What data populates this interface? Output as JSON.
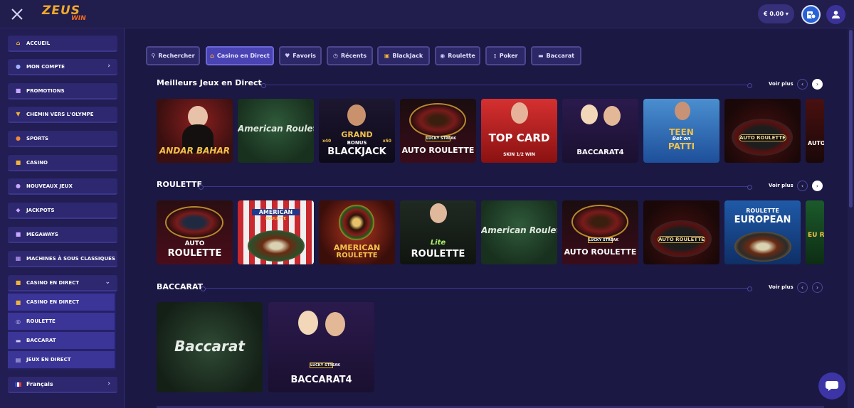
{
  "brand": {
    "logo_top": "ZEUS",
    "logo_bottom": "WIN"
  },
  "header": {
    "balance": "€ 0.00 ▾"
  },
  "sidebar": {
    "items": [
      {
        "label": "ACCUEIL",
        "icon": "home-icon"
      },
      {
        "label": "MON COMPTE",
        "icon": "account-icon",
        "chevron": "›"
      },
      {
        "label": "PROMOTIONS",
        "icon": "gift-icon"
      },
      {
        "label": "CHEMIN VERS L'OLYMPE",
        "icon": "trophy-icon"
      },
      {
        "label": "SPORTS",
        "icon": "ball-icon"
      },
      {
        "label": "CASINO",
        "icon": "casino-icon"
      },
      {
        "label": "NOUVEAUX JEUX",
        "icon": "new-games-icon"
      },
      {
        "label": "JACKPOTS",
        "icon": "jackpot-icon"
      },
      {
        "label": "MEGAWAYS",
        "icon": "megaways-icon"
      },
      {
        "label": "MACHINES À SOUS CLASSIQUES",
        "icon": "slot-icon"
      },
      {
        "label": "CASINO EN DIRECT",
        "icon": "live-casino-icon",
        "chevron": "⌄"
      }
    ],
    "sub_items": [
      {
        "label": "CASINO EN DIRECT",
        "icon": "live-casino-icon"
      },
      {
        "label": "ROULETTE",
        "icon": "roulette-icon"
      },
      {
        "label": "BACCARAT",
        "icon": "baccarat-icon"
      },
      {
        "label": "JEUX EN DIRECT",
        "icon": "live-games-icon"
      }
    ],
    "language": {
      "label": "Français",
      "chevron": "›"
    }
  },
  "tabs": [
    {
      "label": "Rechercher",
      "icon": "search-icon",
      "active": false
    },
    {
      "label": "Casino en Direct",
      "icon": "home-icon",
      "active": true
    },
    {
      "label": "Favoris",
      "icon": "heart-icon",
      "active": false
    },
    {
      "label": "Récents",
      "icon": "clock-icon",
      "active": false
    },
    {
      "label": "BlackJack",
      "icon": "blackjack-icon",
      "active": false
    },
    {
      "label": "Roulette",
      "icon": "roulette-icon",
      "active": false
    },
    {
      "label": "Poker",
      "icon": "poker-icon",
      "active": false
    },
    {
      "label": "Baccarat",
      "icon": "baccarat-icon",
      "active": false
    }
  ],
  "sections": [
    {
      "title": "Meilleurs Jeux en Direct",
      "more": "Voir plus",
      "games": [
        {
          "title": "ANDAR BAHAR"
        },
        {
          "title": "American Roulette"
        },
        {
          "title": "GRAND BONUS BLACKJACK",
          "top": "GRAND",
          "mid": "BONUS",
          "bottom": "BLACKJACK",
          "left_badge": "x40",
          "right_badge": "x50"
        },
        {
          "title": "AUTO ROULETTE",
          "badge": "LUCKY STREAK"
        },
        {
          "title": "TOP CARD",
          "caption": "SKIN 1/2 WIN"
        },
        {
          "title": "BACCARAT4"
        },
        {
          "title": "TEEN PATTI",
          "top": "TEEN",
          "mid": "Bet on",
          "bottom": "PATTI"
        },
        {
          "title": "AUTO ROULETTE"
        },
        {
          "title": "AUTO RO"
        }
      ]
    },
    {
      "title": "ROULETTE",
      "more": "Voir plus",
      "games": [
        {
          "title": "AUTO ROULETTE",
          "top": "AUTO",
          "bottom": "ROULETTE"
        },
        {
          "title": "AMERICAN ROULETTE",
          "top": "AMERICAN",
          "sub": "ROULETTE"
        },
        {
          "title": "AMERICAN ROULETTE",
          "top": "AMERICAN",
          "bottom": "ROULETTE"
        },
        {
          "title": "Lite ROULETTE",
          "top": "Lite",
          "bottom": "ROULETTE"
        },
        {
          "title": "American Roulette"
        },
        {
          "title": "AUTO ROULETTE",
          "badge": "LUCKY STREAK"
        },
        {
          "title": "AUTO ROULETTE"
        },
        {
          "title": "ROULETTE EUROPEAN",
          "top": "ROULETTE",
          "bottom": "EUROPEAN"
        },
        {
          "title": "EU R"
        }
      ]
    },
    {
      "title": "BACCARAT",
      "more": "Voir plus",
      "games": [
        {
          "title": "Baccarat"
        },
        {
          "title": "BACCARAT4",
          "badge": "LUCKY STREAK"
        }
      ]
    }
  ],
  "colors": {
    "bg": "#1b1843",
    "sidebar": "#221d52",
    "accent": "#4a43b4",
    "gold": "#f0b23a"
  }
}
